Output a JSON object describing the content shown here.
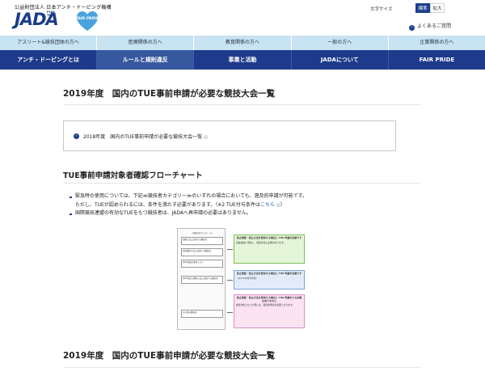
{
  "header": {
    "org_name": "公益財団法人 日本アンチ・ドーピング機構",
    "logo_text": "JADA",
    "logo_sub": "PLAY TRUE",
    "fair_badge_text": "FAIR PRIDE",
    "text_size_label": "文字サイズ",
    "size_standard": "標準",
    "size_large": "拡大",
    "faq_label": "よくあるご質問",
    "colors": {
      "brand": "#1e3a8a",
      "audience_bar": "#c8e3f1",
      "fair_badge": "#4aa3df"
    }
  },
  "audience_nav": [
    "アスリート&競技団体の方へ",
    "医療関係の方へ",
    "教育関係の方へ",
    "一般の方へ",
    "企業関係の方へ"
  ],
  "main_nav": [
    {
      "label": "アンチ・ドーピングとは",
      "active": false
    },
    {
      "label": "ルールと規則違反",
      "active": true
    },
    {
      "label": "事業と活動",
      "active": false
    },
    {
      "label": "JADAについて",
      "active": false
    },
    {
      "label": "FAIR PRIDE",
      "active": false
    }
  ],
  "page": {
    "title": "2019年度　国内のTUE事前申請が必要な競技大会一覧",
    "related_link": "2018年度　国内のTUE事前申請が必要な競技大会一覧",
    "section_title": "TUE事前申請対象者確認フローチャート",
    "bullets": {
      "b1_line1": "緊急時の使用については、下記≪競技者カテゴリー≫のいずれの場合においても、遡及的申請が可能です。",
      "b1_line2_prefix": "ただし、TUEが認められるには、条件を満たす必要があります。（※2 TUE付与条件は",
      "b1_line2_link": "こちら",
      "b1_line2_suffix": "）",
      "b2": "国際競技連盟の有効なTUEをもつ競技者は、JADAへ再申請の必要はありません。"
    },
    "bottom_title": "2019年度　国内のTUE事前申請が必要な競技大会一覧"
  },
  "flowchart": {
    "left_header": "≪競技者カテゴリー≫",
    "left_boxes": [
      "国際大会に出場する競技者",
      "国内競技大会に出場する競技者",
      "JADA検査対象者リスト",
      "JADA指定の競技大会に参加する競技者",
      "その他の競技者"
    ],
    "green_title": "禁止物質・禁止方法を使用する場合に TUE 申請が必要です",
    "green_body": "競技会前に申請し、承認を得る必要があります。",
    "blue_title": "禁止物質・禁止方法を使用する場合に TUE 申請が必要です",
    "blue_body": "（※2 TUE付与条件）",
    "pink_title": "禁止物質・禁止方法を使用する場合に TUE 申請をする必要はありません",
    "pink_body": "検査対象となった際には、遡及的申請が必要となります。"
  }
}
